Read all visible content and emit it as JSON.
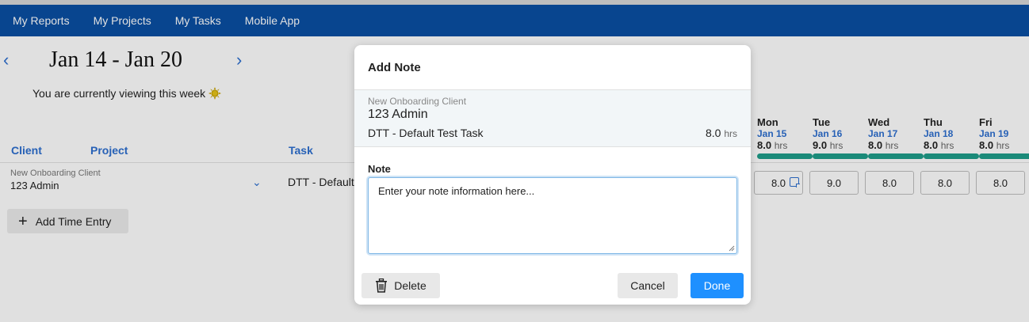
{
  "nav": {
    "items": [
      "My Reports",
      "My Projects",
      "My Tasks",
      "Mobile App"
    ]
  },
  "week": {
    "title": "Jan 14 - Jan 20",
    "viewing_text": "You are currently viewing this week"
  },
  "table": {
    "headers": {
      "client": "Client",
      "project": "Project",
      "task": "Task"
    },
    "row": {
      "client_sub": "New Onboarding Client",
      "client_main": "123 Admin",
      "task": "DTT - Default"
    },
    "add_time_label": "Add Time Entry",
    "hours_unit": "hrs",
    "days": [
      {
        "name": "Mon",
        "date": "Jan 15",
        "total": "8.0",
        "cell": "8.0",
        "has_note": true
      },
      {
        "name": "Tue",
        "date": "Jan 16",
        "total": "9.0",
        "cell": "9.0",
        "has_note": false
      },
      {
        "name": "Wed",
        "date": "Jan 17",
        "total": "8.0",
        "cell": "8.0",
        "has_note": false
      },
      {
        "name": "Thu",
        "date": "Jan 18",
        "total": "8.0",
        "cell": "8.0",
        "has_note": false
      },
      {
        "name": "Fri",
        "date": "Jan 19",
        "total": "8.0",
        "cell": "8.0",
        "has_note": false
      }
    ]
  },
  "modal": {
    "title": "Add Note",
    "client": "New Onboarding Client",
    "project": "123 Admin",
    "task": "DTT - Default Test Task",
    "hours": "8.0",
    "hours_unit": "hrs",
    "note_label": "Note",
    "note_value": "Enter your note information here...",
    "delete_label": "Delete",
    "cancel_label": "Cancel",
    "done_label": "Done"
  },
  "colors": {
    "navbar": "#0a4fa3",
    "accent": "#2d6fd0",
    "progress": "#1e9e8a",
    "done_button": "#1e90ff"
  }
}
